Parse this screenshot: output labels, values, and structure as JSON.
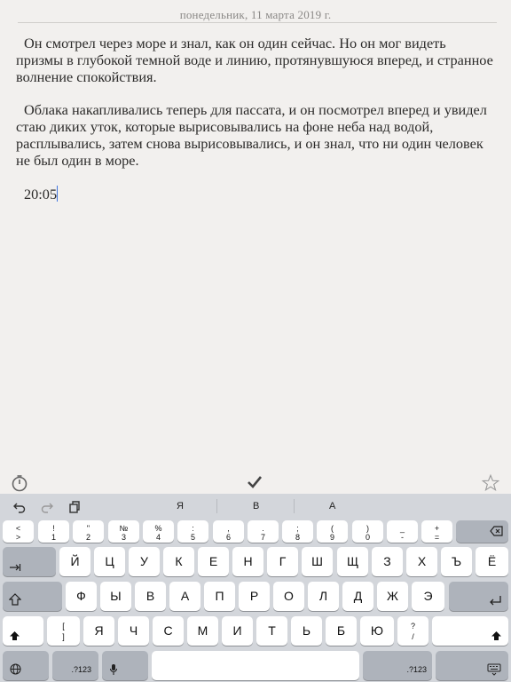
{
  "header": {
    "date": "понедельник, 11 марта 2019 г."
  },
  "editor": {
    "paragraphs": [
      "Он смотрел через море и знал, как он один сейчас. Но он мог видеть призмы в глубокой темной воде и линию, протянувшуюся вперед, и странное волнение спокойствия.",
      "Облака накапливались теперь для пассата, и он посмотрел вперед и увидел стаю диких уток, которые вырисовывались на фоне неба над водой, расплывались, затем снова вырисовывались, и он знал, что ни один человек не был один в море."
    ],
    "time_text": "20:05"
  },
  "toolbar_icons": [
    "timer-icon",
    "check-icon",
    "star-icon"
  ],
  "keyboard": {
    "suggestions": [
      "Я",
      "В",
      "А"
    ],
    "number_row": [
      {
        "top": "<",
        "bottom": ">"
      },
      {
        "top": "!",
        "bottom": "1"
      },
      {
        "top": "\"",
        "bottom": "2"
      },
      {
        "top": "№",
        "bottom": "3"
      },
      {
        "top": "%",
        "bottom": "4"
      },
      {
        "top": ":",
        "bottom": "5"
      },
      {
        "top": ",",
        "bottom": "6"
      },
      {
        "top": ".",
        "bottom": "7"
      },
      {
        "top": ";",
        "bottom": "8"
      },
      {
        "top": "(",
        "bottom": "9"
      },
      {
        "top": ")",
        "bottom": "0"
      },
      {
        "top": "_",
        "bottom": "-"
      },
      {
        "top": "+",
        "bottom": "="
      }
    ],
    "row1": [
      "Й",
      "Ц",
      "У",
      "К",
      "Е",
      "Н",
      "Г",
      "Ш",
      "Щ",
      "З",
      "Х",
      "Ъ",
      "Ё"
    ],
    "row2": [
      "Ф",
      "Ы",
      "В",
      "А",
      "П",
      "Р",
      "О",
      "Л",
      "Д",
      "Ж",
      "Э"
    ],
    "row3": [
      "Я",
      "Ч",
      "С",
      "М",
      "И",
      "Т",
      "Ь",
      "Б",
      "Ю"
    ],
    "row3_left_bracket": {
      "top": "[",
      "bottom": "]"
    },
    "row3_right_symbol": {
      "top": "?",
      "bottom": "/"
    },
    "num_switch_label": ".?123",
    "icons": [
      "undo-icon",
      "redo-icon",
      "clipboard-icon",
      "backspace-icon",
      "tab-icon",
      "caps-icon",
      "return-icon",
      "shift-icon",
      "globe-icon",
      "microphone-icon",
      "keyboard-dismiss-icon"
    ]
  }
}
